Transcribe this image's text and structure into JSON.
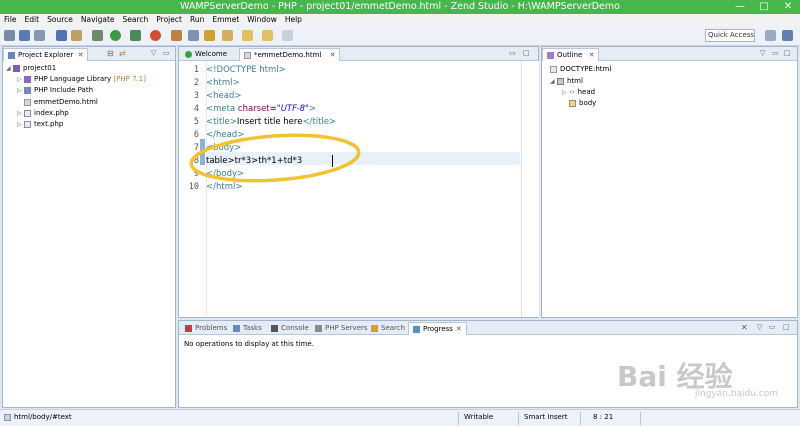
{
  "window": {
    "title": "WAMPServerDemo - PHP - project01/emmetDemo.html - Zend Studio - H:\\WAMPServerDemo",
    "minimize": "—",
    "maximize": "□",
    "close": "✕"
  },
  "menu": [
    "File",
    "Edit",
    "Source",
    "Navigate",
    "Search",
    "Project",
    "Run",
    "Emmet",
    "Window",
    "Help"
  ],
  "toolbar": {
    "quick_access_placeholder": "Quick Access"
  },
  "project_explorer": {
    "tab_label": "Project Explorer",
    "tab_close": "✕",
    "tree": {
      "root": "project01",
      "items": [
        {
          "label": "PHP Language Library",
          "suffix": "[PHP 7.1]"
        },
        {
          "label": "PHP Include Path",
          "suffix": ""
        },
        {
          "label": "emmetDemo.html",
          "suffix": ""
        },
        {
          "label": "index.php",
          "suffix": ""
        },
        {
          "label": "text.php",
          "suffix": ""
        }
      ]
    }
  },
  "editor": {
    "tabs": [
      {
        "label": "Welcome",
        "close": ""
      },
      {
        "label": "*emmetDemo.html",
        "close": "✕"
      }
    ],
    "line_numbers": [
      "1",
      "2",
      "3",
      "4",
      "5",
      "6",
      "7",
      "8",
      "9",
      "10"
    ],
    "code": {
      "l1": "<!DOCTYPE html>",
      "l2": "<html>",
      "l3": "<head>",
      "l4_tag": "<meta",
      "l4_attr": " charset",
      "l4_eq": "=",
      "l4_val": "\"UTF-8\"",
      "l4_end": ">",
      "l5_open": "<title>",
      "l5_text": "Insert title here",
      "l5_close": "</title>",
      "l6": "</head>",
      "l7": "<body>",
      "l8": "table>tr*3>th*1+td*3",
      "l9": "</body>",
      "l10": "</html>"
    }
  },
  "outline": {
    "tab_label": "Outline",
    "tab_close": "✕",
    "items": [
      "DOCTYPE:html",
      "html",
      "head",
      "body"
    ]
  },
  "bottom_panel": {
    "tabs": [
      "Problems",
      "Tasks",
      "Console",
      "PHP Servers",
      "Search",
      "Progress"
    ],
    "progress_close": "✕",
    "message": "No operations to display at this time."
  },
  "status": {
    "path": "html/body/#text",
    "mode": "Writable",
    "insert": "Smart Insert",
    "position": "8 : 21"
  },
  "watermark": {
    "main": "Bai 经验",
    "sub": "jingyan.baidu.com"
  },
  "colors": {
    "titlebar": "#45b74c",
    "highlight_circle": "#f1c232"
  }
}
